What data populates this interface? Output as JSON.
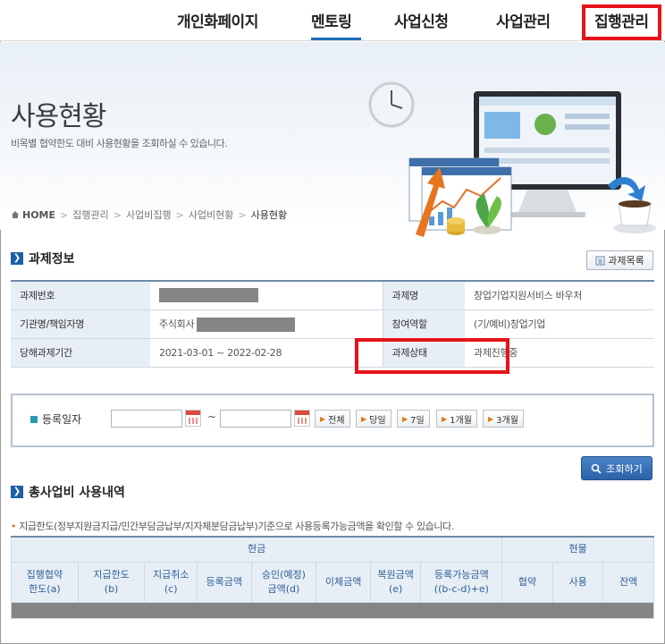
{
  "nav": {
    "items": [
      "개인화페이지",
      "멘토링",
      "사업신청",
      "사업관리",
      "집행관리"
    ],
    "active": "멘토링",
    "highlighted": "집행관리"
  },
  "hero": {
    "title": "사용현황",
    "subtitle": "비목별 협약한도 대비 사용현황을 조회하실 수 있습니다."
  },
  "breadcrumb": {
    "home": "HOME",
    "items": [
      "집행관리",
      "사업비집행",
      "사업비현황"
    ],
    "current": "사용현황"
  },
  "task_info": {
    "section_title": "과제정보",
    "list_button": "과제목록",
    "rows": [
      {
        "label1": "과제번호",
        "value1": "",
        "label2": "과제명",
        "value2": "창업기업지원서비스 바우처"
      },
      {
        "label1": "기관명/책임자명",
        "value1": "주식회사",
        "label2": "참여역할",
        "value2": "(기/예비)창업기업"
      },
      {
        "label1": "당해과제기간",
        "value1": "2021-03-01 ~ 2022-02-28",
        "label2": "과제상태",
        "value2": "과제진행중"
      }
    ]
  },
  "search": {
    "label": "등록일자",
    "from": "",
    "to": "",
    "tilde": "~",
    "periods": [
      "전체",
      "당일",
      "7일",
      "1개월",
      "3개월"
    ],
    "query_button": "조회하기"
  },
  "usage": {
    "section_title": "총사업비 사용내역",
    "note": "지급한도(정부지원금지급/민간부담금납부/지자체분담금납부)기준으로 사용등록가능금액을 확인할 수 있습니다.",
    "group_cash": "현금",
    "group_kind": "현물",
    "columns": [
      "집행협약\n한도(a)",
      "지급한도\n(b)",
      "지급취소\n(c)",
      "등록금액",
      "승인(예정)\n금액(d)",
      "이체금액",
      "복원금액\n(e)",
      "등록가능금액\n((b-c-d)+e)",
      "협약",
      "사용",
      "잔액"
    ]
  },
  "colors": {
    "accent": "#1d6ab7",
    "highlight": "#e5141b",
    "header_bg": "#e7eef6"
  }
}
